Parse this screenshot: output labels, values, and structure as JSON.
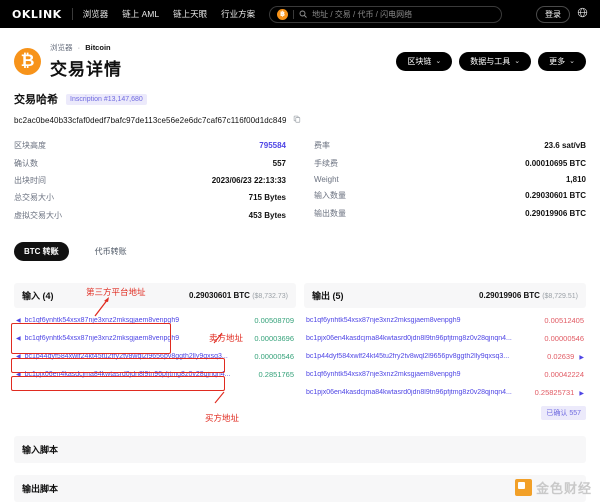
{
  "topnav": {
    "logo": "OKLINK",
    "links": [
      "浏览器",
      "链上 AML",
      "链上天眼",
      "行业方案"
    ],
    "search_placeholder": "地址 / 交易 / 代币 / 闪电网络",
    "search_value": "",
    "chip": "฿",
    "login_label": "登录",
    "globe_icon": "globe-icon",
    "search_icon": "search-icon"
  },
  "header": {
    "breadcrumb_root": "浏览器",
    "breadcrumb_sep": "·",
    "breadcrumb_current": "Bitcoin",
    "title": "交易详情",
    "logo_glyph": "₿",
    "actions": [
      {
        "label": "区块链",
        "chevron": "⌄"
      },
      {
        "label": "数据与工具",
        "chevron": "⌄"
      },
      {
        "label": "更多",
        "chevron": "⌄"
      }
    ]
  },
  "hash": {
    "label": "交易哈希",
    "inscription_badge": "Inscription #13,147,680",
    "value": "bc2ac0be40b33cfaf0dedf7bafc97de113ce56e2e6dc7caf67c116f00d1dc849",
    "copy_icon": "copy-icon"
  },
  "stats": {
    "left": [
      {
        "label": "区块高度",
        "value": "795584",
        "link": true
      },
      {
        "label": "确认数",
        "value": "557",
        "link": false
      },
      {
        "label": "出块时间",
        "value": "2023/06/23 22:13:33",
        "link": false
      },
      {
        "label": "总交易大小",
        "value": "715 Bytes",
        "link": false
      },
      {
        "label": "虚拟交易大小",
        "value": "453 Bytes",
        "link": false
      }
    ],
    "right": [
      {
        "label": "费率",
        "value": "23.6 sat/vB",
        "link": false
      },
      {
        "label": "手续费",
        "value": "0.00010695 BTC",
        "link": false
      },
      {
        "label": "Weight",
        "value": "1,810",
        "link": false
      },
      {
        "label": "输入数量",
        "value": "0.29030601 BTC",
        "link": false
      },
      {
        "label": "输出数量",
        "value": "0.29019906 BTC",
        "link": false
      }
    ]
  },
  "tabs": [
    {
      "label": "BTC 转账",
      "active": true
    },
    {
      "label": "代币转账",
      "active": false
    }
  ],
  "inputs": {
    "title": "输入 (4)",
    "total_btc": "0.29030601 BTC",
    "total_usd": "($8,732.73)",
    "rows": [
      {
        "address": "bc1qf6ynhtk54xsx87nje3xnz2mksgjaem8venpgh9",
        "amount": "0.00508709",
        "caret": "◀"
      },
      {
        "address": "bc1qf6ynhtk54xsx87nje3xnz2mksgjaem8venpgh9",
        "amount": "0.00003696",
        "caret": "◀"
      },
      {
        "address": "bc1p44dyf584xwlf24kt45tu2fry2tv8wql2l9656pv8ggth2lly9qxsq3...",
        "amount": "0.00000546",
        "caret": "◀"
      },
      {
        "address": "bc1pjx06en4kasdcjma84kwtasrd0jdn8l9tn96pfjtmg8z0v28qjnqn4...",
        "amount": "0.2851765",
        "caret": "◀"
      }
    ]
  },
  "outputs": {
    "title": "输出 (5)",
    "total_btc": "0.29019906 BTC",
    "total_usd": "($8,729.51)",
    "confirm_badge": "已确认 557",
    "rows": [
      {
        "address": "bc1qf6ynhtk54xsx87nje3xnz2mksgjaem8venpgh9",
        "amount": "0.00512405",
        "play": false
      },
      {
        "address": "bc1pjx06en4kasdcjma84kwtasrd0jdn8l9tn96pfjtmg8z0v28qjnqn4...",
        "amount": "0.00000546",
        "play": false
      },
      {
        "address": "bc1p44dyf584xwlf24kt45tu2fry2tv8wql2l9656pv8ggth2lly9qxsq3...",
        "amount": "0.02639",
        "play": true
      },
      {
        "address": "bc1qf6ynhtk54xsx87nje3xnz2mksgjaem8venpgh9",
        "amount": "0.00042224",
        "play": false
      },
      {
        "address": "bc1pjx06en4kasdcjma84kwtasrd0jdn8l9tn96pfjtmg8z0v28qjnqn4...",
        "amount": "0.25825731",
        "play": true
      }
    ]
  },
  "annotations": {
    "third_party": "第三方平台地址",
    "seller": "卖方地址",
    "buyer": "买方地址",
    "color": "#e02b20"
  },
  "scripts": {
    "input_script": "输入脚本",
    "output_script": "输出脚本"
  },
  "watermark": {
    "text": "金色财经",
    "logo_color": "#f2a028"
  }
}
